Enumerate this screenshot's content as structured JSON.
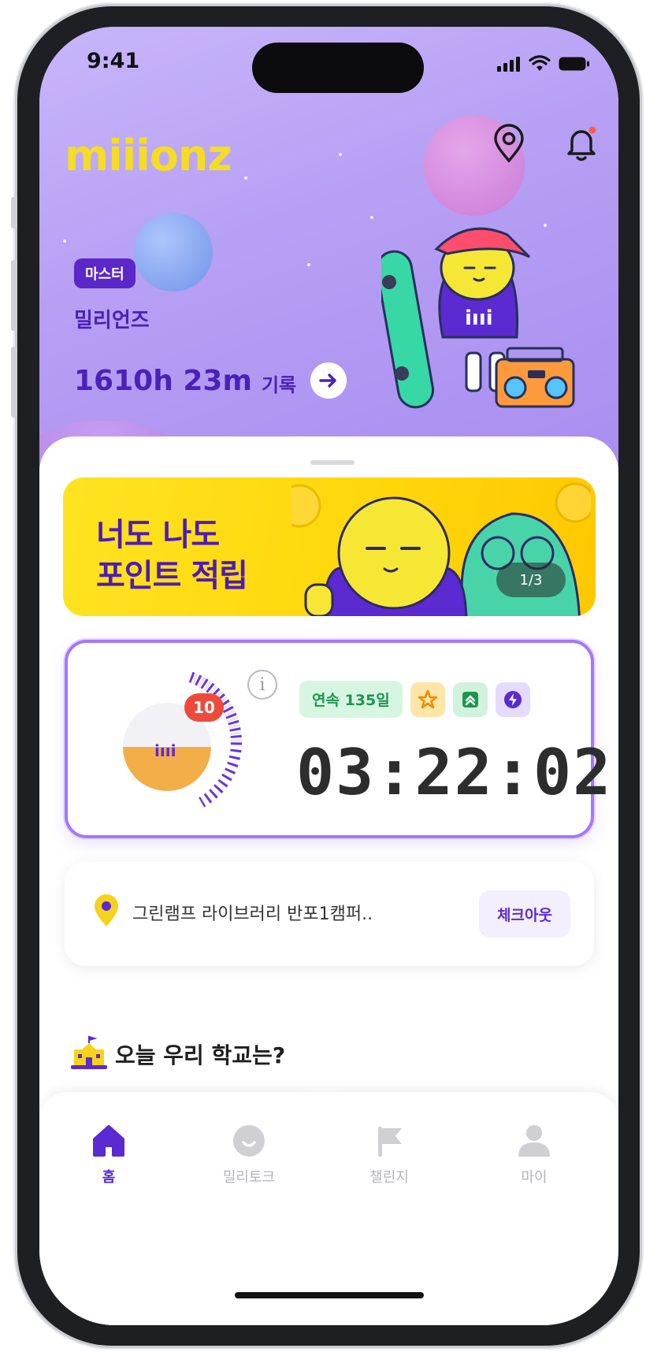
{
  "status_bar": {
    "time": "9:41"
  },
  "header": {
    "logo": "miiionz"
  },
  "profile": {
    "grade_badge": "마스터",
    "name": "밀리언즈",
    "record_time": "1610h 23m",
    "record_label": "기록"
  },
  "banner": {
    "line1": "너도 나도",
    "line2": "포인트 적립",
    "pager": "1/3"
  },
  "timer": {
    "count_badge": "10",
    "streak": "연속 135일",
    "clock": "03:22:02"
  },
  "checkin": {
    "place": "그린램프 라이브러리 반포1캠퍼..",
    "checkout_label": "체크아웃"
  },
  "section": {
    "title": "오늘 우리 학교는?"
  },
  "tabbar": {
    "items": [
      {
        "label": "홈",
        "icon": "home-icon"
      },
      {
        "label": "밀리토크",
        "icon": "chat-icon"
      },
      {
        "label": "챌린지",
        "icon": "flag-icon"
      },
      {
        "label": "마이",
        "icon": "person-icon"
      }
    ]
  },
  "colors": {
    "brand_purple": "#5b2ad1",
    "logo_yellow": "#f6dc22",
    "streak_green": "#1c9650",
    "card_border": "#a476ff"
  }
}
